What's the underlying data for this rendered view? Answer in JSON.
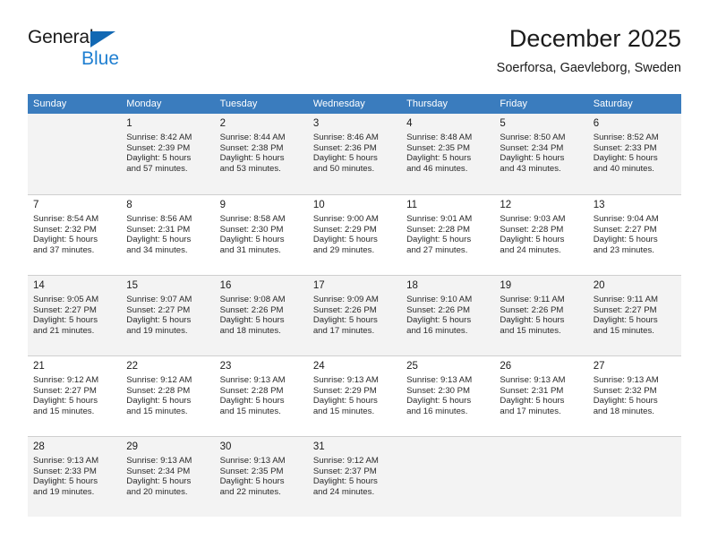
{
  "brand": {
    "name_top": "General",
    "name_bottom": "Blue",
    "triangle_icon": "blue-triangle-logo",
    "accent_color": "#1f7fd1"
  },
  "header": {
    "title": "December 2025",
    "subtitle": "Soerforsa, Gaevleborg, Sweden"
  },
  "colors": {
    "header_row_bg": "#3a7cbe",
    "header_row_text": "#ffffff",
    "shaded_row_bg": "#f3f3f3",
    "grid_line": "#cfcfcf",
    "text": "#1b1b1b"
  },
  "weekday_headers": [
    "Sunday",
    "Monday",
    "Tuesday",
    "Wednesday",
    "Thursday",
    "Friday",
    "Saturday"
  ],
  "weeks": [
    {
      "shaded": true,
      "days": [
        {
          "day": "",
          "detail": ""
        },
        {
          "day": "1",
          "detail": "Sunrise: 8:42 AM\nSunset: 2:39 PM\nDaylight: 5 hours\nand 57 minutes."
        },
        {
          "day": "2",
          "detail": "Sunrise: 8:44 AM\nSunset: 2:38 PM\nDaylight: 5 hours\nand 53 minutes."
        },
        {
          "day": "3",
          "detail": "Sunrise: 8:46 AM\nSunset: 2:36 PM\nDaylight: 5 hours\nand 50 minutes."
        },
        {
          "day": "4",
          "detail": "Sunrise: 8:48 AM\nSunset: 2:35 PM\nDaylight: 5 hours\nand 46 minutes."
        },
        {
          "day": "5",
          "detail": "Sunrise: 8:50 AM\nSunset: 2:34 PM\nDaylight: 5 hours\nand 43 minutes."
        },
        {
          "day": "6",
          "detail": "Sunrise: 8:52 AM\nSunset: 2:33 PM\nDaylight: 5 hours\nand 40 minutes."
        }
      ]
    },
    {
      "shaded": false,
      "days": [
        {
          "day": "7",
          "detail": "Sunrise: 8:54 AM\nSunset: 2:32 PM\nDaylight: 5 hours\nand 37 minutes."
        },
        {
          "day": "8",
          "detail": "Sunrise: 8:56 AM\nSunset: 2:31 PM\nDaylight: 5 hours\nand 34 minutes."
        },
        {
          "day": "9",
          "detail": "Sunrise: 8:58 AM\nSunset: 2:30 PM\nDaylight: 5 hours\nand 31 minutes."
        },
        {
          "day": "10",
          "detail": "Sunrise: 9:00 AM\nSunset: 2:29 PM\nDaylight: 5 hours\nand 29 minutes."
        },
        {
          "day": "11",
          "detail": "Sunrise: 9:01 AM\nSunset: 2:28 PM\nDaylight: 5 hours\nand 27 minutes."
        },
        {
          "day": "12",
          "detail": "Sunrise: 9:03 AM\nSunset: 2:28 PM\nDaylight: 5 hours\nand 24 minutes."
        },
        {
          "day": "13",
          "detail": "Sunrise: 9:04 AM\nSunset: 2:27 PM\nDaylight: 5 hours\nand 23 minutes."
        }
      ]
    },
    {
      "shaded": true,
      "days": [
        {
          "day": "14",
          "detail": "Sunrise: 9:05 AM\nSunset: 2:27 PM\nDaylight: 5 hours\nand 21 minutes."
        },
        {
          "day": "15",
          "detail": "Sunrise: 9:07 AM\nSunset: 2:27 PM\nDaylight: 5 hours\nand 19 minutes."
        },
        {
          "day": "16",
          "detail": "Sunrise: 9:08 AM\nSunset: 2:26 PM\nDaylight: 5 hours\nand 18 minutes."
        },
        {
          "day": "17",
          "detail": "Sunrise: 9:09 AM\nSunset: 2:26 PM\nDaylight: 5 hours\nand 17 minutes."
        },
        {
          "day": "18",
          "detail": "Sunrise: 9:10 AM\nSunset: 2:26 PM\nDaylight: 5 hours\nand 16 minutes."
        },
        {
          "day": "19",
          "detail": "Sunrise: 9:11 AM\nSunset: 2:26 PM\nDaylight: 5 hours\nand 15 minutes."
        },
        {
          "day": "20",
          "detail": "Sunrise: 9:11 AM\nSunset: 2:27 PM\nDaylight: 5 hours\nand 15 minutes."
        }
      ]
    },
    {
      "shaded": false,
      "days": [
        {
          "day": "21",
          "detail": "Sunrise: 9:12 AM\nSunset: 2:27 PM\nDaylight: 5 hours\nand 15 minutes."
        },
        {
          "day": "22",
          "detail": "Sunrise: 9:12 AM\nSunset: 2:28 PM\nDaylight: 5 hours\nand 15 minutes."
        },
        {
          "day": "23",
          "detail": "Sunrise: 9:13 AM\nSunset: 2:28 PM\nDaylight: 5 hours\nand 15 minutes."
        },
        {
          "day": "24",
          "detail": "Sunrise: 9:13 AM\nSunset: 2:29 PM\nDaylight: 5 hours\nand 15 minutes."
        },
        {
          "day": "25",
          "detail": "Sunrise: 9:13 AM\nSunset: 2:30 PM\nDaylight: 5 hours\nand 16 minutes."
        },
        {
          "day": "26",
          "detail": "Sunrise: 9:13 AM\nSunset: 2:31 PM\nDaylight: 5 hours\nand 17 minutes."
        },
        {
          "day": "27",
          "detail": "Sunrise: 9:13 AM\nSunset: 2:32 PM\nDaylight: 5 hours\nand 18 minutes."
        }
      ]
    },
    {
      "shaded": true,
      "days": [
        {
          "day": "28",
          "detail": "Sunrise: 9:13 AM\nSunset: 2:33 PM\nDaylight: 5 hours\nand 19 minutes."
        },
        {
          "day": "29",
          "detail": "Sunrise: 9:13 AM\nSunset: 2:34 PM\nDaylight: 5 hours\nand 20 minutes."
        },
        {
          "day": "30",
          "detail": "Sunrise: 9:13 AM\nSunset: 2:35 PM\nDaylight: 5 hours\nand 22 minutes."
        },
        {
          "day": "31",
          "detail": "Sunrise: 9:12 AM\nSunset: 2:37 PM\nDaylight: 5 hours\nand 24 minutes."
        },
        {
          "day": "",
          "detail": ""
        },
        {
          "day": "",
          "detail": ""
        },
        {
          "day": "",
          "detail": ""
        }
      ]
    }
  ]
}
